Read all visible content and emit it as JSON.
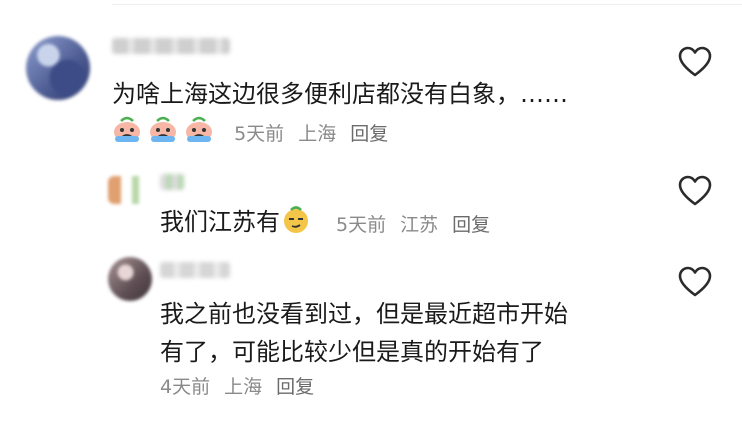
{
  "comments": [
    {
      "text": "为啥上海这边很多便利店都没有白象，……",
      "time": "5天前",
      "location": "上海",
      "reply_label": "回复",
      "emoji": "crying-face-emoji"
    },
    {
      "text": "我们江苏有",
      "time": "5天前",
      "location": "江苏",
      "reply_label": "回复",
      "emoji": "smirk-face-emoji"
    },
    {
      "text_line1": "我之前也没看到过，但是最近超市开始",
      "text_line2": "有了，可能比较少但是真的开始有了",
      "time": "4天前",
      "location": "上海",
      "reply_label": "回复"
    }
  ],
  "icons": {
    "like": "heart-icon"
  },
  "colors": {
    "text": "#1a1a1a",
    "meta": "#8a8a8a",
    "heart_stroke": "#2b2b2b"
  }
}
